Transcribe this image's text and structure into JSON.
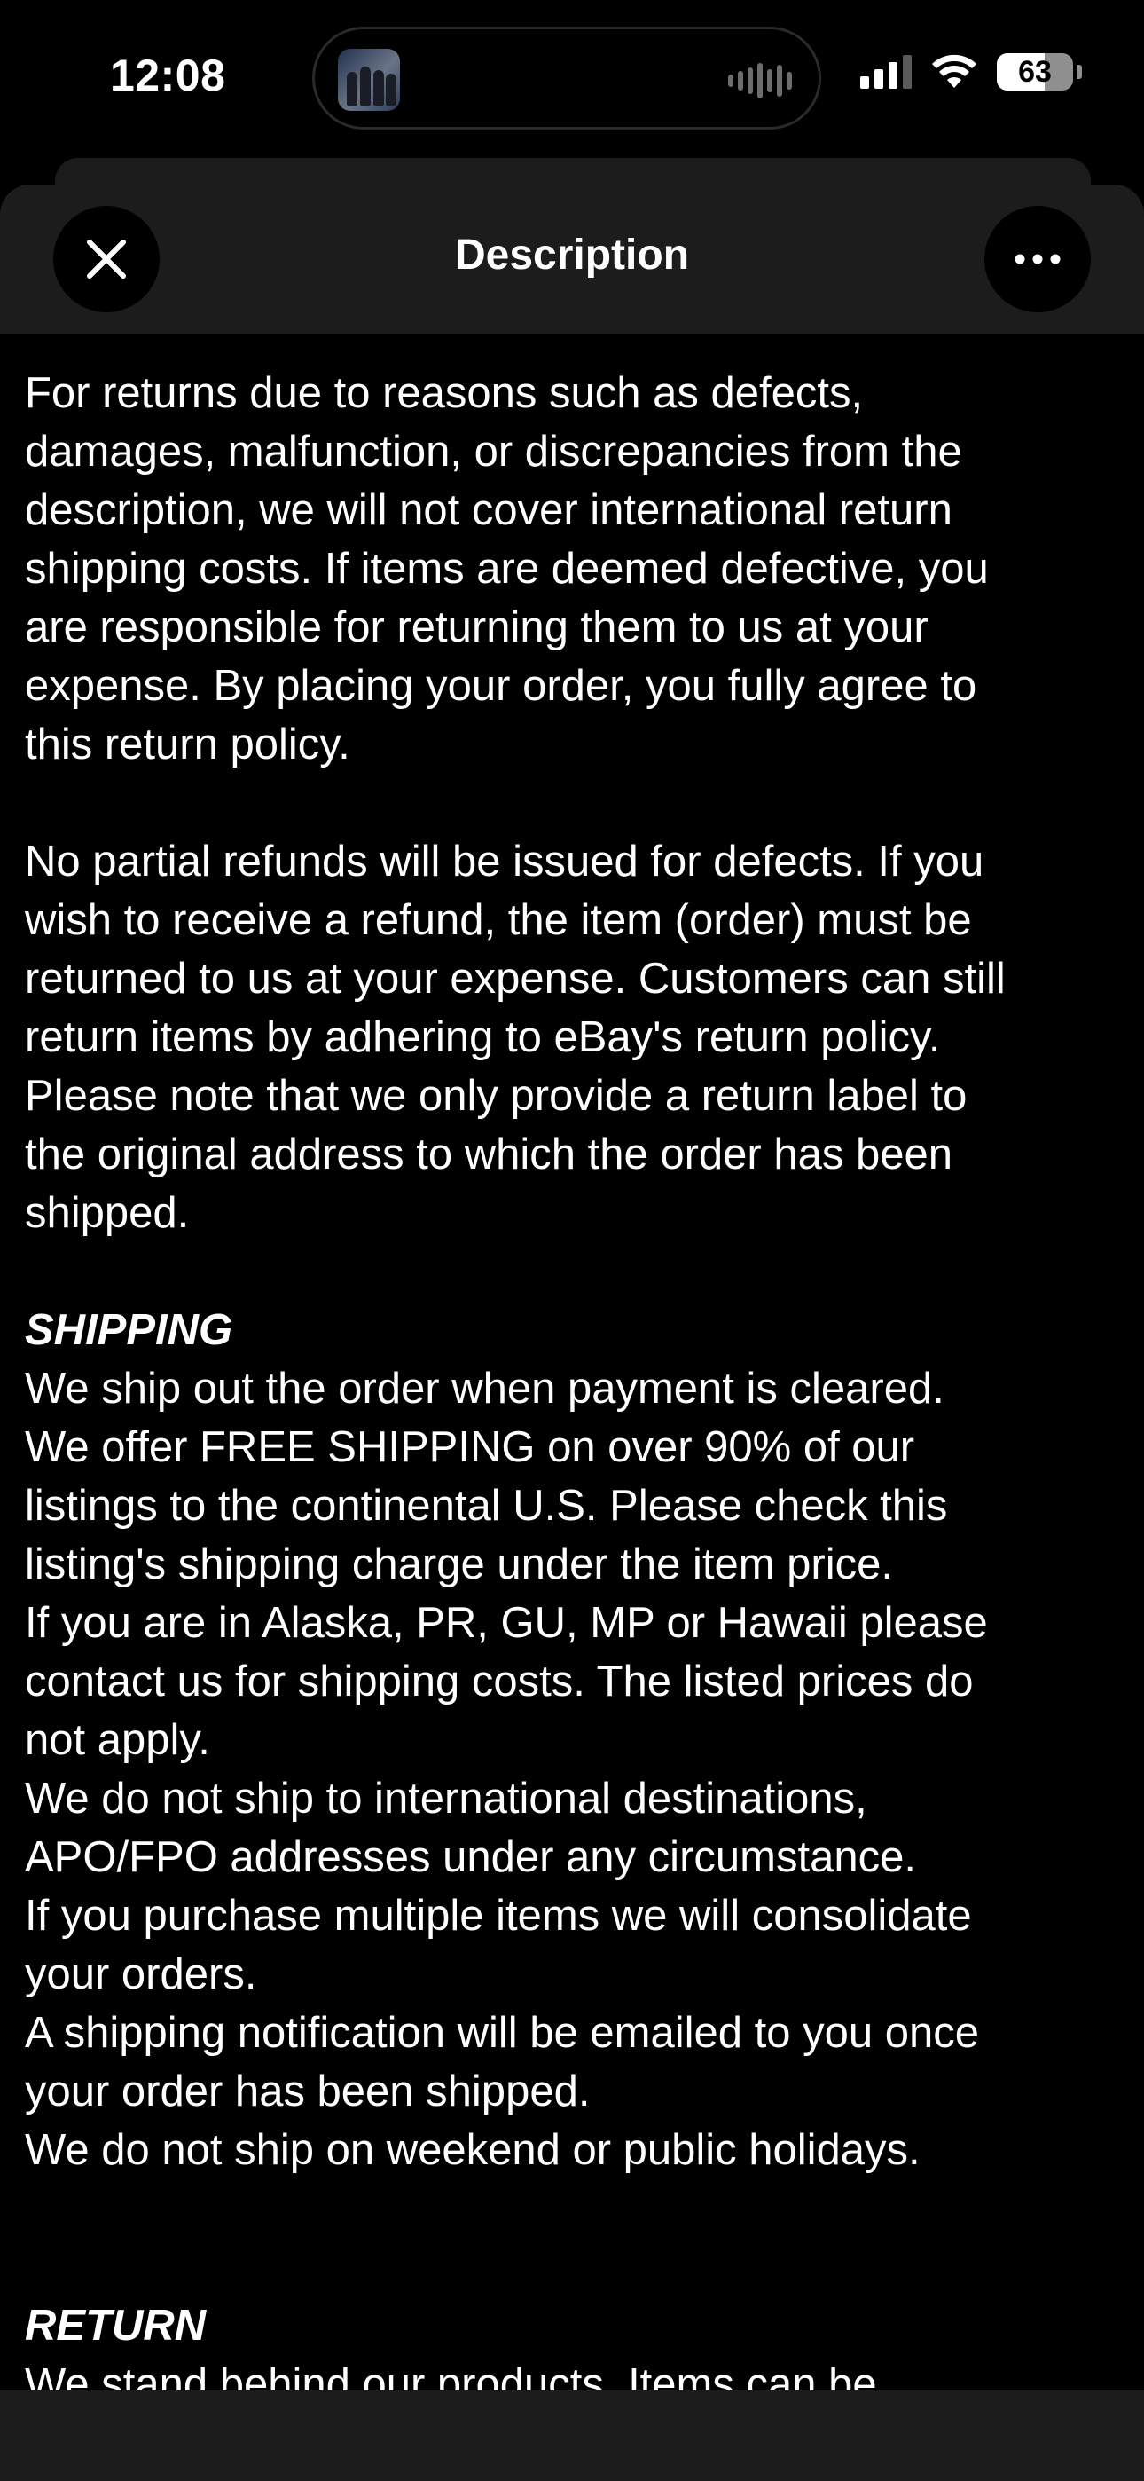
{
  "status_bar": {
    "time": "12:08",
    "battery_percent": "63",
    "battery_level": 0.63,
    "icons": [
      "signal-icon",
      "wifi-icon",
      "battery-icon"
    ]
  },
  "dynamic_island": {
    "icons": [
      "album-art-icon",
      "audio-waveform-icon"
    ]
  },
  "sheet": {
    "title": "Description",
    "close_icon": "close-icon",
    "more_icon": "more-icon"
  },
  "description": {
    "paragraphs": [
      "For returns due to reasons such as defects,\ndamages, malfunction, or discrepancies from the\ndescription, we will not cover international return\nshipping costs. If items are deemed defective, you\nare responsible for returning them to us at your\nexpense. By placing your order, you fully agree to\nthis return policy.",
      "No partial refunds will be issued for defects. If you\nwish to receive a refund, the item (order) must be\nreturned to us at your expense. Customers can still\nreturn items by adhering to eBay's return policy.\nPlease note that we only provide a return label to\nthe original address to which the order has been\nshipped."
    ],
    "shipping_heading": "SHIPPING",
    "shipping_text": "We ship out the order when payment is cleared.\nWe offer FREE SHIPPING on over 90% of our\nlistings to the continental U.S. Please check this\nlisting's shipping charge under the item price.\nIf you are in Alaska, PR, GU, MP or Hawaii please\ncontact us for shipping costs. The listed prices do\nnot apply.\nWe do not ship to international destinations,\nAPO/FPO addresses under any circumstance.\nIf you purchase multiple items we will consolidate\nyour orders.\nA shipping notification will be emailed to you once\nyour order has been shipped.\nWe do not ship on weekend or public holidays.",
    "return_heading": "RETURN",
    "return_text": "We stand behind our products. Items can be"
  }
}
